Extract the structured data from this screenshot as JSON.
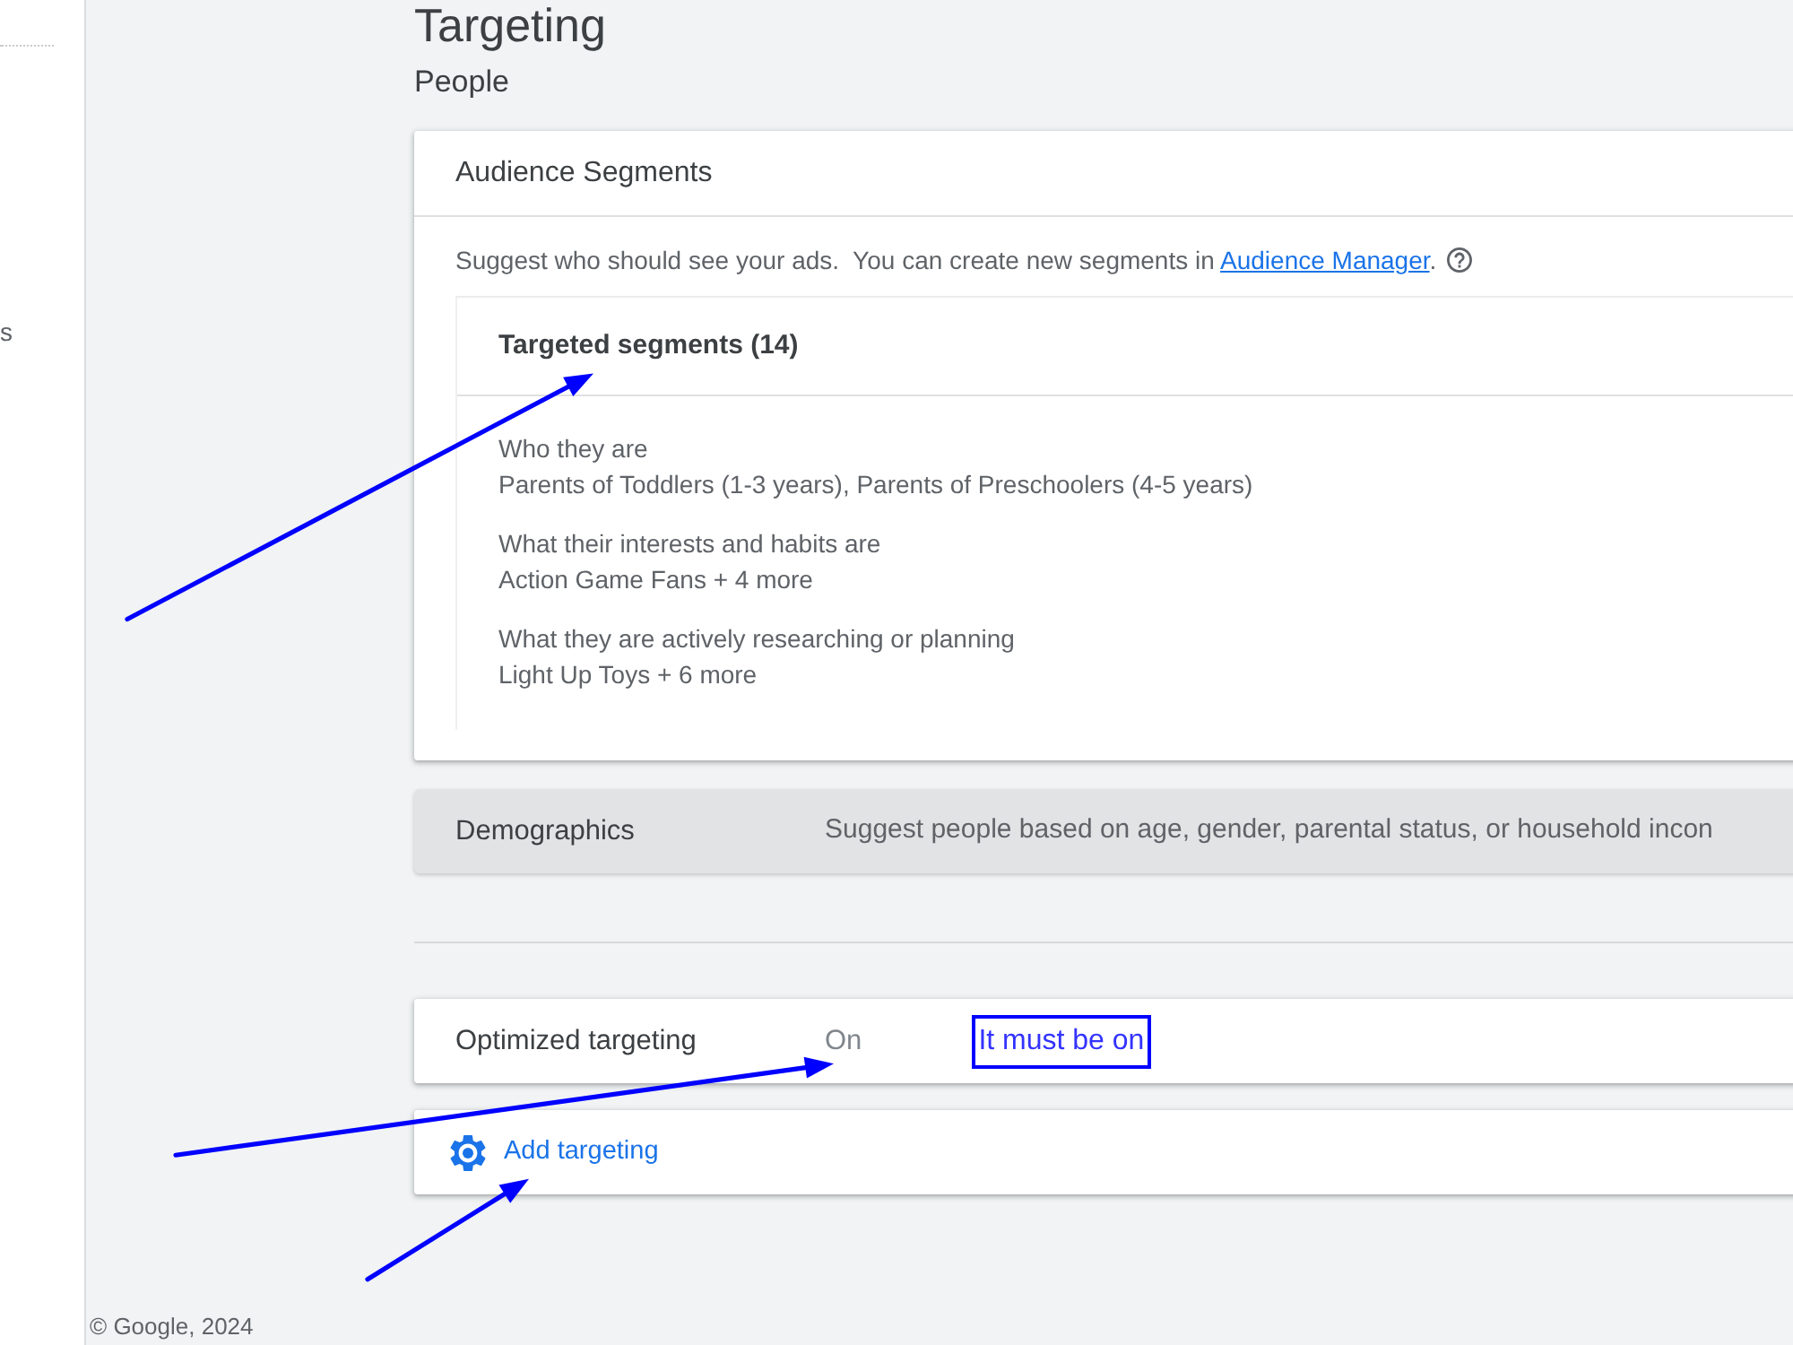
{
  "page": {
    "title": "Targeting",
    "section": "People"
  },
  "sidebar": {
    "items": [
      {
        "label": "s"
      }
    ]
  },
  "audience_segments": {
    "title": "Audience Segments",
    "description": {
      "text": "Suggest who should see your ads.  You can create new segments in ",
      "link": "Audience Manager",
      "after": "."
    },
    "targeted_segments": {
      "title": "Targeted segments (14)",
      "arrow": true,
      "groups": [
        {
          "label": "Who they are",
          "value": "Parents of Toddlers (1-3 years), Parents of Preschoolers (4-5 years)"
        },
        {
          "label": "What their interests and habits are",
          "value": "Action Game Fans + 4 more"
        },
        {
          "label": "What they are actively researching or planning",
          "value": "Light Up Toys + 6 more"
        }
      ]
    }
  },
  "demographics": {
    "title": "Demographics",
    "description": "Suggest people based on age, gender, parental status, or household incon"
  },
  "optimized_targeting": {
    "title": "Optimized targeting",
    "value": "On",
    "arrow": true,
    "note": "It must be on"
  },
  "add_targeting": {
    "label": "Add targeting",
    "arrow": true
  },
  "footer": "© Google, 2024"
}
